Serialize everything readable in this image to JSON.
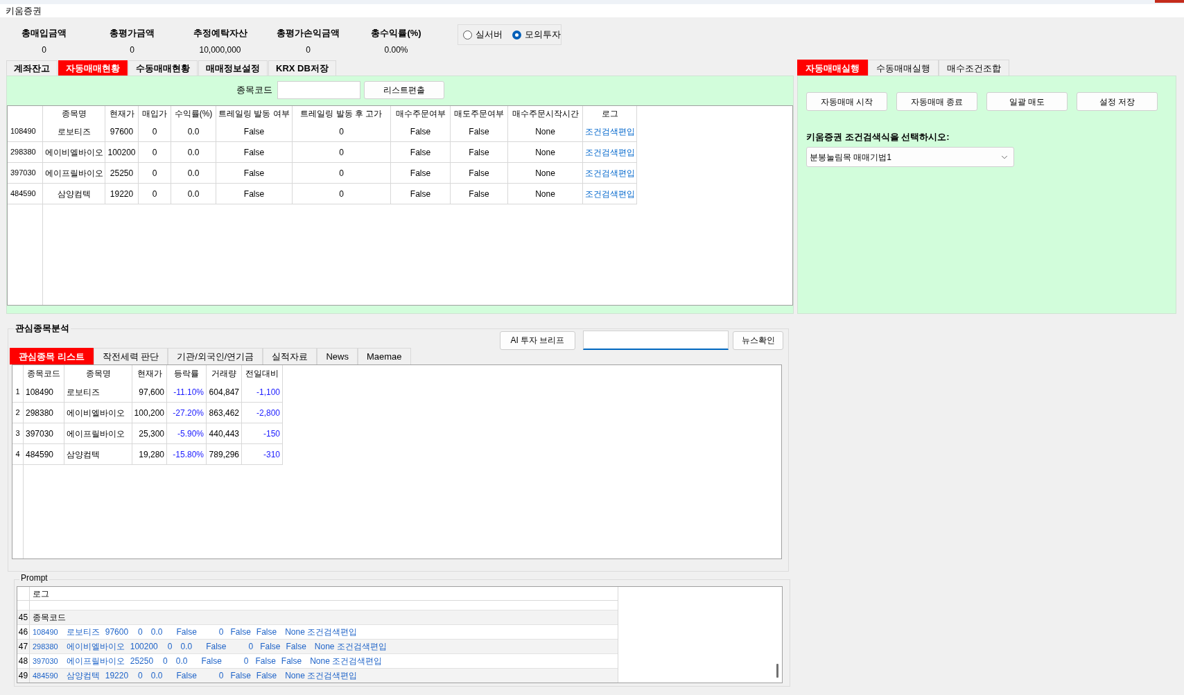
{
  "window": {
    "title": "키움증권"
  },
  "summary": [
    {
      "label": "총매입금액",
      "value": "0"
    },
    {
      "label": "총평가금액",
      "value": "0"
    },
    {
      "label": "추정예탁자산",
      "value": "10,000,000"
    },
    {
      "label": "총평가손익금액",
      "value": "0"
    },
    {
      "label": "총수익률(%)",
      "value": "0.00%"
    }
  ],
  "server_mode": [
    {
      "label": "실서버",
      "selected": false
    },
    {
      "label": "모의투자",
      "selected": true
    }
  ],
  "left_tabs": [
    {
      "label": "계좌잔고",
      "selected": false
    },
    {
      "label": "자동매매현황",
      "selected": true
    },
    {
      "label": "수동매매현황",
      "selected": false
    },
    {
      "label": "매매정보설정",
      "selected": false
    },
    {
      "label": "KRX DB저장",
      "selected": false
    }
  ],
  "stock_code_bar": {
    "label": "종목코드",
    "button": "리스트편출"
  },
  "positions_table": {
    "columns": [
      "종목명",
      "현재가",
      "매입가",
      "수익률(%)",
      "트레일링 발동 여부",
      "트레일링 발동 후 고가",
      "매수주문여부",
      "매도주문여부",
      "매수주문시작시간",
      "로그"
    ],
    "rows": [
      {
        "code": "108490",
        "cells": [
          "로보티즈",
          "97600",
          "0",
          "0.0",
          "False",
          "0",
          "False",
          "False",
          "None"
        ],
        "log": "조건검색편입"
      },
      {
        "code": "298380",
        "cells": [
          "에이비엘바이오",
          "100200",
          "0",
          "0.0",
          "False",
          "0",
          "False",
          "False",
          "None"
        ],
        "log": "조건검색편입"
      },
      {
        "code": "397030",
        "cells": [
          "에이프릴바이오",
          "25250",
          "0",
          "0.0",
          "False",
          "0",
          "False",
          "False",
          "None"
        ],
        "log": "조건검색편입"
      },
      {
        "code": "484590",
        "cells": [
          "삼양컴텍",
          "19220",
          "0",
          "0.0",
          "False",
          "0",
          "False",
          "False",
          "None"
        ],
        "log": "조건검색편입"
      }
    ]
  },
  "right_tabs": [
    {
      "label": "자동매매실행",
      "selected": true
    },
    {
      "label": "수동매매실행",
      "selected": false
    },
    {
      "label": "매수조건조합",
      "selected": false
    }
  ],
  "auto_trade": {
    "buttons": [
      "자동매매 시작",
      "자동매매 종료",
      "일괄 매도",
      "설정 저장"
    ],
    "condition_label": "키움증권 조건검색식을 선택하시오:",
    "condition_value": "분봉눌림목 매매기법1"
  },
  "watchlist": {
    "title": "관심종목분석",
    "brief_button": "AI 투자 브리프",
    "news_button": "뉴스확인",
    "tabs": [
      {
        "label": "관심종목 리스트",
        "selected": true
      },
      {
        "label": "작전세력 판단",
        "selected": false
      },
      {
        "label": "기관/외국인/연기금",
        "selected": false
      },
      {
        "label": "실적자료",
        "selected": false
      },
      {
        "label": "News",
        "selected": false
      },
      {
        "label": "Maemae",
        "selected": false
      }
    ],
    "table": {
      "columns": [
        "종목코드",
        "종목명",
        "현재가",
        "등락률",
        "거래량",
        "전일대비"
      ],
      "rows": [
        {
          "index": "1",
          "cells": [
            "108490",
            "로보티즈",
            "97,600",
            "-11.10%",
            "604,847",
            "-1,100"
          ]
        },
        {
          "index": "2",
          "cells": [
            "298380",
            "에이비엘바이오",
            "100,200",
            "-27.20%",
            "863,462",
            "-2,800"
          ]
        },
        {
          "index": "3",
          "cells": [
            "397030",
            "에이프릴바이오",
            "25,300",
            "-5.90%",
            "440,443",
            "-150"
          ]
        },
        {
          "index": "4",
          "cells": [
            "484590",
            "삼양컴텍",
            "19,280",
            "-15.80%",
            "789,296",
            "-310"
          ]
        }
      ]
    }
  },
  "prompt": {
    "title": "Prompt",
    "header": "로그",
    "rows": [
      {
        "number": "45",
        "kind": "heading",
        "fields": [
          "종목코드"
        ]
      },
      {
        "number": "46",
        "kind": "record",
        "fields": [
          "108490",
          "로보티즈",
          "97600",
          "0",
          "0.0",
          "False",
          "0",
          "False",
          "False",
          "None",
          "조건검색편입"
        ]
      },
      {
        "number": "47",
        "kind": "record",
        "fields": [
          "298380",
          "에이비엘바이오",
          "100200",
          "0",
          "0.0",
          "False",
          "0",
          "False",
          "False",
          "None",
          "조건검색편입"
        ]
      },
      {
        "number": "48",
        "kind": "record",
        "fields": [
          "397030",
          "에이프릴바이오",
          "25250",
          "0",
          "0.0",
          "False",
          "0",
          "False",
          "False",
          "None",
          "조건검색편입"
        ]
      },
      {
        "number": "49",
        "kind": "record",
        "fields": [
          "484590",
          "삼양컴텍",
          "19220",
          "0",
          "0.0",
          "False",
          "0",
          "False",
          "False",
          "None",
          "조건검색편입"
        ]
      }
    ]
  }
}
